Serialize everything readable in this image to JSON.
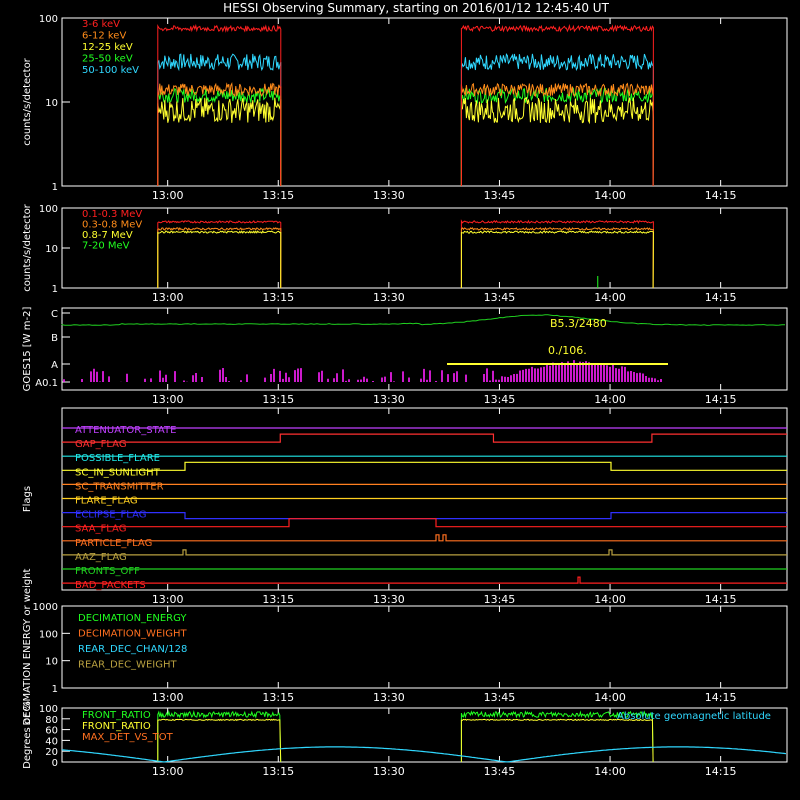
{
  "title": "HESSI Observing Summary, starting on 2016/01/12 12:45:40 UT",
  "time_axis": {
    "start": "12:45:40",
    "end": "14:24",
    "ticks": [
      "13:00",
      "13:15",
      "13:30",
      "13:45",
      "14:00",
      "14:15"
    ]
  },
  "chart_data": [
    {
      "type": "line",
      "name": "hxr",
      "ylabel": "counts/s/detector",
      "yscale": "log",
      "ylim": [
        1,
        100
      ],
      "yticks": [
        "1",
        "10",
        "100"
      ],
      "legend": [
        "3-6 keV",
        "6-12 keV",
        "12-25 keV",
        "25-50 keV",
        "50-100 keV"
      ],
      "colors": [
        "#ff2020",
        "#ff8c1a",
        "#ffff30",
        "#20ff20",
        "#30d8ff"
      ],
      "intervals": [
        [
          "12:58:40",
          "13:15:20"
        ],
        [
          "13:39:50",
          "14:05:50"
        ]
      ],
      "levels": [
        75,
        14,
        8,
        12,
        30
      ]
    },
    {
      "type": "line",
      "name": "gamma",
      "ylabel": "counts/s/detector",
      "yscale": "log",
      "ylim": [
        1,
        100
      ],
      "yticks": [
        "1",
        "10",
        "100"
      ],
      "legend": [
        "0.1-0.3 MeV",
        "0.3-0.8 MeV",
        "0.8-7 MeV",
        "7-20 MeV"
      ],
      "colors": [
        "#ff2020",
        "#ff8c1a",
        "#ffff30",
        "#20ff20"
      ],
      "intervals": [
        [
          "12:58:40",
          "13:15:20"
        ],
        [
          "13:39:50",
          "14:05:50"
        ]
      ],
      "levels": [
        45,
        30,
        25,
        0
      ]
    },
    {
      "type": "line",
      "name": "goes",
      "ylabel": "GOES15 [W m-2]",
      "yticks": [
        "A0.1",
        "A",
        "B",
        "C"
      ],
      "annotations": [
        "B5.3/2480",
        "0./106."
      ]
    },
    {
      "type": "line",
      "name": "flags",
      "ylabel": "Flags",
      "legend": [
        "ATTENUATOR_STATE",
        "GAP_FLAG",
        "POSSIBLE_FLARE",
        "SC_IN_SUNLIGHT",
        "SC_TRANSMITTER",
        "FLARE_FLAG",
        "ECLIPSE_FLAG",
        "SAA_FLAG",
        "PARTICLE_FLAG",
        "AAZ_FLAG",
        "FRONTS_OFF",
        "BAD_PACKETS"
      ],
      "colors": [
        "#c040ff",
        "#ff3030",
        "#20e8e8",
        "#ffff30",
        "#ff8020",
        "#ffd020",
        "#3030ff",
        "#ff2020",
        "#ff7020",
        "#b8a040",
        "#20d020",
        "#ff2020"
      ]
    },
    {
      "type": "line",
      "name": "decimation",
      "ylabel": "DECIMATION ENERGY or weight",
      "yscale": "log",
      "ylim": [
        1,
        1000
      ],
      "yticks": [
        "1",
        "10",
        "100",
        "1000"
      ],
      "legend": [
        "DECIMATION_ENERGY",
        "DECIMATION_WEIGHT",
        "REAR_DEC_CHAN/128",
        "REAR_DEC_WEIGHT"
      ],
      "colors": [
        "#20ff20",
        "#ff7020",
        "#30d8ff",
        "#b8a040"
      ]
    },
    {
      "type": "line",
      "name": "ratios",
      "ylabel": "Degrees or %",
      "ylim": [
        0,
        100
      ],
      "yticks": [
        "0",
        "20",
        "40",
        "60",
        "80",
        "100"
      ],
      "legend": [
        "FRONT_RATIO",
        "FRONT_RATIO",
        "MAX_DET_VS_TOT"
      ],
      "colors": [
        "#20ff20",
        "#ffff30",
        "#ff7020"
      ],
      "annotation": "Absolute geomagnetic latitude",
      "annotation_color": "#30d8ff"
    }
  ]
}
